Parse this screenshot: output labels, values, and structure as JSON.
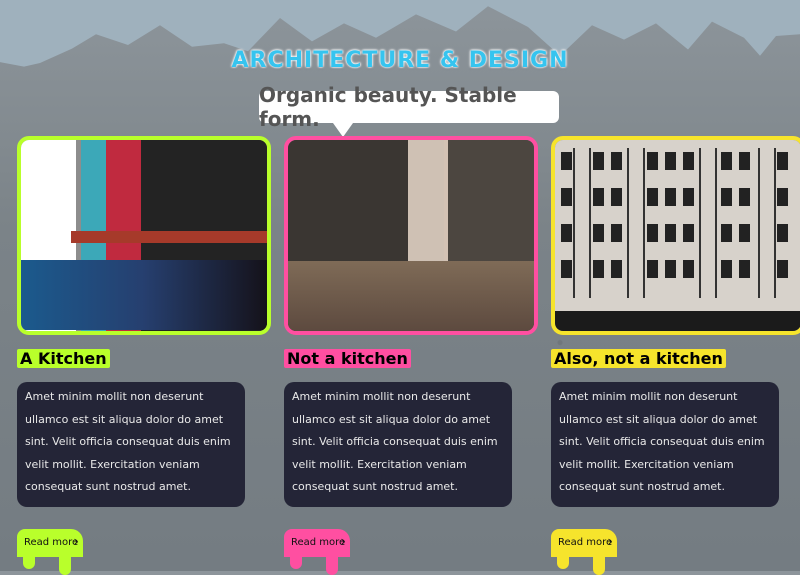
{
  "header": {
    "title": "ARCHITECTURE & DESIGN",
    "subtitle": "Organic beauty. Stable form."
  },
  "cards": [
    {
      "title": "A Kitchen",
      "accent": "#b9ff2b",
      "text": "Amet minim mollit non deserunt ullamco est sit aliqua dolor do amet sint. Velit officia consequat duis enim velit mollit. Exercitation veniam consequat sunt nostrud amet.",
      "button": "Read more"
    },
    {
      "title": "Not a kitchen",
      "accent": "#ff4fa1",
      "text": "Amet minim mollit non deserunt ullamco est sit aliqua dolor do amet sint. Velit officia consequat duis enim velit mollit. Exercitation veniam consequat sunt nostrud amet.",
      "button": "Read more"
    },
    {
      "title": "Also, not a kitchen",
      "accent": "#f6e42c",
      "text": "Amet minim mollit non deserunt ullamco est sit aliqua dolor do amet sint. Velit officia consequat duis enim velit mollit. Exercitation veniam consequat sunt nostrud amet.",
      "button": "Read more"
    }
  ]
}
